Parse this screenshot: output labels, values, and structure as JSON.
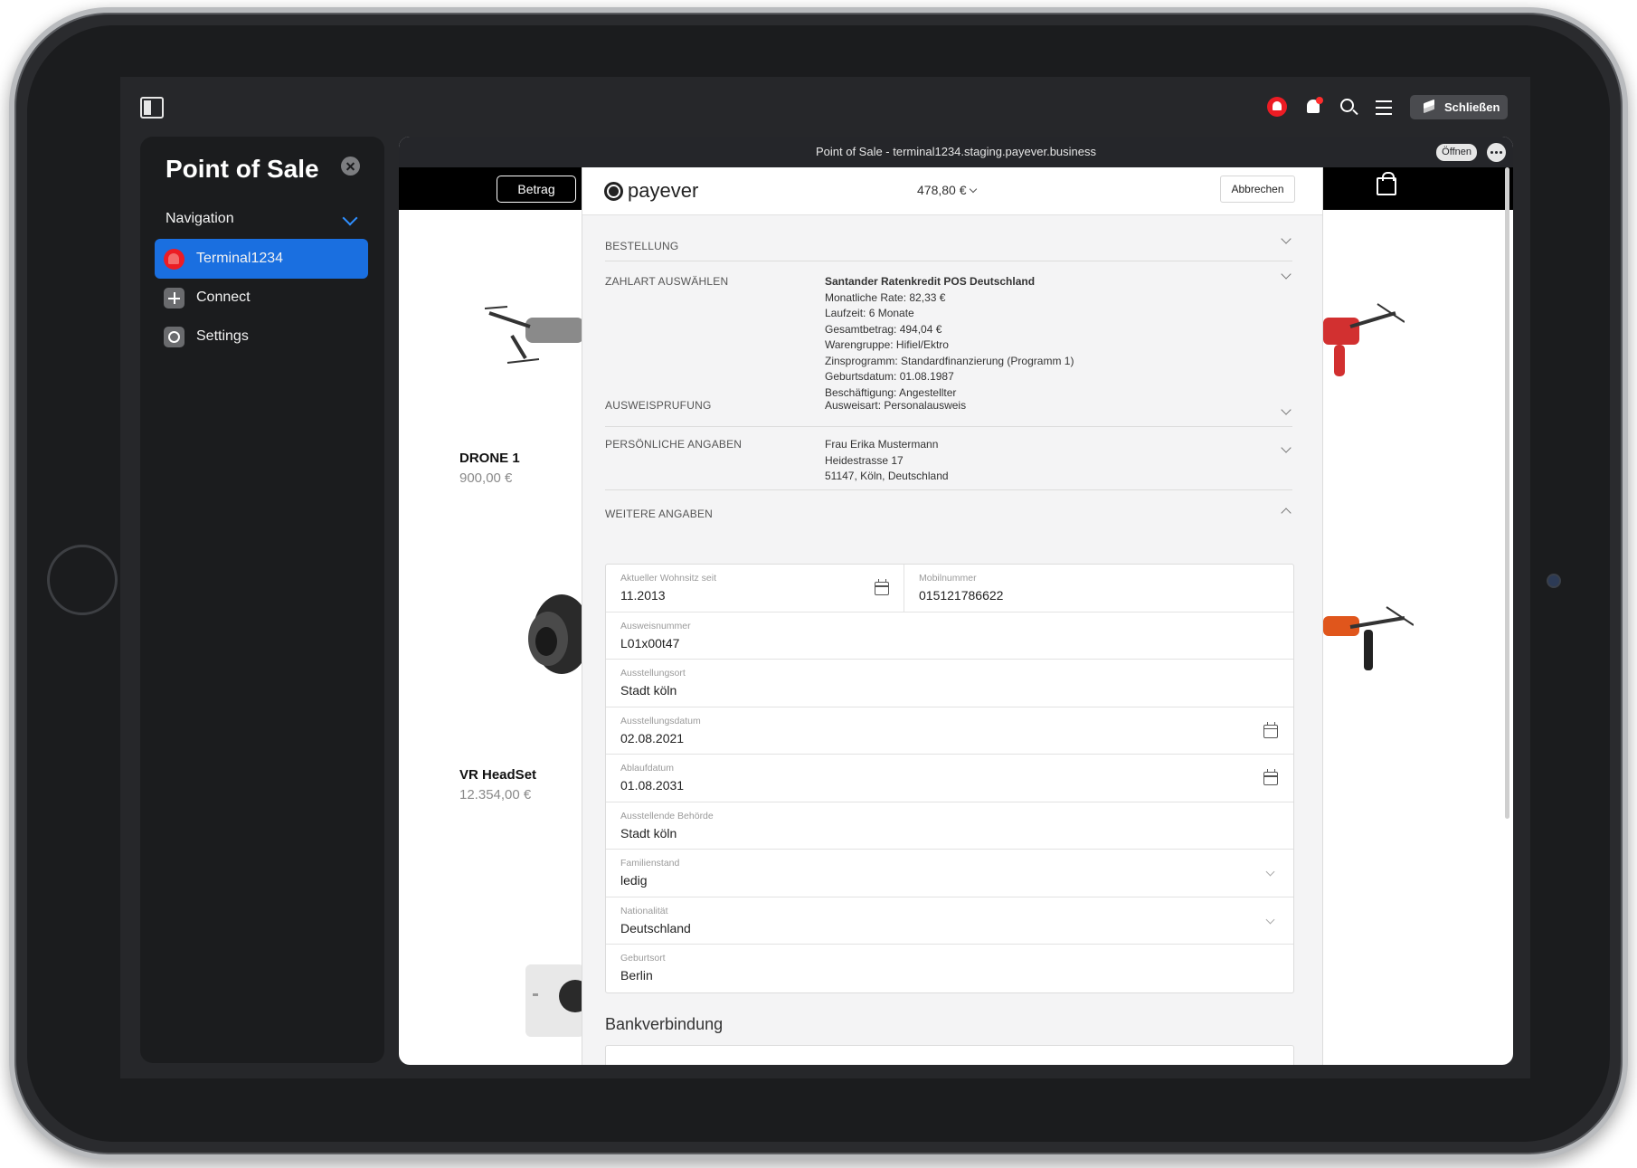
{
  "topbar": {
    "close_app_label": "Schließen"
  },
  "sidebar": {
    "title": "Point of Sale",
    "nav_header": "Navigation",
    "items": [
      {
        "label": "Terminal1234"
      },
      {
        "label": "Connect"
      },
      {
        "label": "Settings"
      }
    ]
  },
  "window": {
    "title": "Point of Sale - terminal1234.staging.payever.business",
    "open_label": "Öffnen"
  },
  "shop": {
    "amount_button": "Betrag",
    "products": [
      {
        "name": "DRONE 1",
        "price": "900,00 €"
      },
      {
        "name": "VR HeadSet",
        "price": "12.354,00 €"
      }
    ]
  },
  "checkout": {
    "logo_text": "payever",
    "amount": "478,80 €",
    "cancel_label": "Abbrechen",
    "sections": {
      "order": {
        "label": "BESTELLUNG"
      },
      "payment": {
        "label": "ZAHLART AUSWÄHLEN",
        "title": "Santander Ratenkredit POS Deutschland",
        "lines": [
          "Monatliche Rate: 82,33 €",
          "Laufzeit: 6 Monate",
          "Gesamtbetrag: 494,04 €",
          "Warengruppe: Hifiel/Ektro",
          "Zinsprogramm: Standardfinanzierung (Programm 1)",
          "Geburtsdatum: 01.08.1987",
          "Beschäftigung: Angestellter"
        ]
      },
      "id_check": {
        "label": "AUSWEISPRUFUNG",
        "value": "Ausweisart: Personalausweis"
      },
      "personal": {
        "label": "PERSÖNLICHE ANGABEN",
        "lines": [
          "Frau Erika Mustermann",
          "Heidestrasse 17",
          "51147, Köln, Deutschland"
        ]
      },
      "more": {
        "label": "WEITERE ANGABEN"
      }
    },
    "form": {
      "residence_since": {
        "label": "Aktueller Wohnsitz seit",
        "value": "11.2013"
      },
      "mobile": {
        "label": "Mobilnummer",
        "value": "015121786622"
      },
      "id_number": {
        "label": "Ausweisnummer",
        "value": "L01x00t47"
      },
      "issue_place": {
        "label": "Ausstellungsort",
        "value": "Stadt köln"
      },
      "issue_date": {
        "label": "Ausstellungsdatum",
        "value": "02.08.2021"
      },
      "expiry_date": {
        "label": "Ablaufdatum",
        "value": "01.08.2031"
      },
      "authority": {
        "label": "Ausstellende Behörde",
        "value": "Stadt köln"
      },
      "marital_status": {
        "label": "Familienstand",
        "value": "ledig"
      },
      "nationality": {
        "label": "Nationalität",
        "value": "Deutschland"
      },
      "birthplace": {
        "label": "Geburtsort",
        "value": "Berlin"
      }
    },
    "bank_title": "Bankverbindung"
  },
  "colors": {
    "accent": "#1a6fe0",
    "santander": "#ec1c24",
    "sidebar_bg": "#1b1c1e"
  }
}
